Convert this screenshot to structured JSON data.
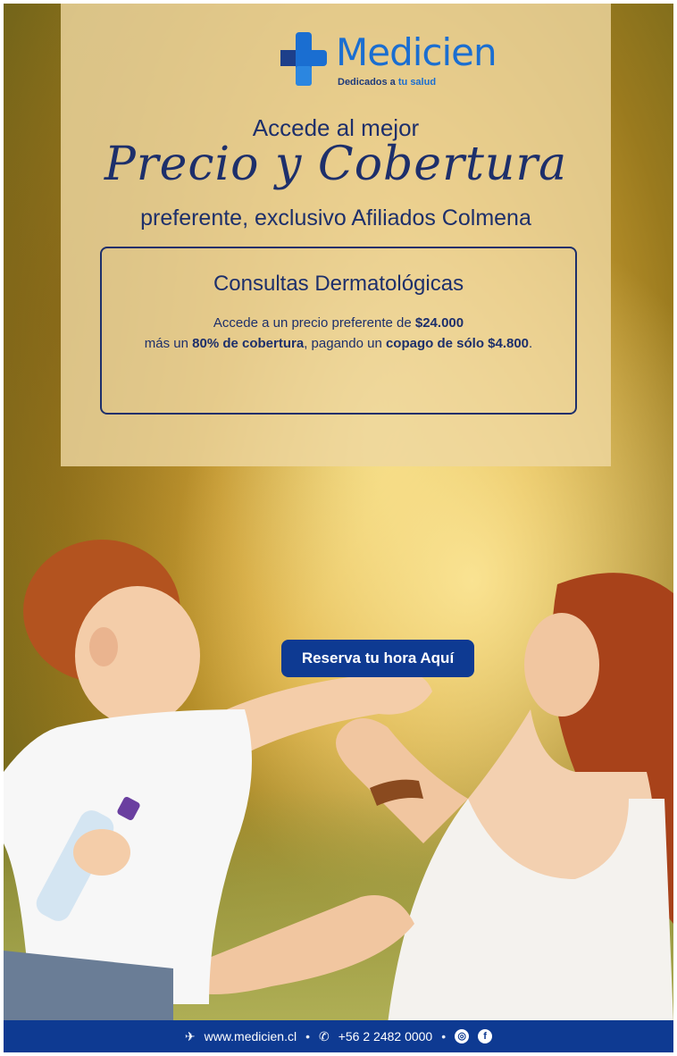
{
  "brand": {
    "name": "Medicien",
    "tagline_prefix": "Dedicados a",
    "tagline_accent": "tu salud",
    "color_primary": "#1a6ed1",
    "color_dark": "#1d2f6b"
  },
  "hero": {
    "headline": "Accede al mejor",
    "script_title": "Precio y Cobertura",
    "subheadline": "preferente, exclusivo Afiliados Colmena"
  },
  "offer": {
    "title": "Consultas Dermatológicas",
    "line1_prefix": "Accede a un precio preferente de ",
    "line1_price": "$24.000",
    "line2_prefix": "más un ",
    "line2_coverage": "80% de cobertura",
    "line2_middle": ", pagando un ",
    "line2_copay": "copago de sólo $4.800",
    "line2_suffix": "."
  },
  "cta": {
    "label": "Reserva tu hora Aquí",
    "color": "#0e3a92"
  },
  "footer": {
    "website": "www.medicien.cl",
    "phone": "+56 2 2482 0000",
    "separator": "•",
    "icons": [
      "web-icon",
      "phone-icon",
      "instagram-icon",
      "facebook-icon"
    ]
  }
}
